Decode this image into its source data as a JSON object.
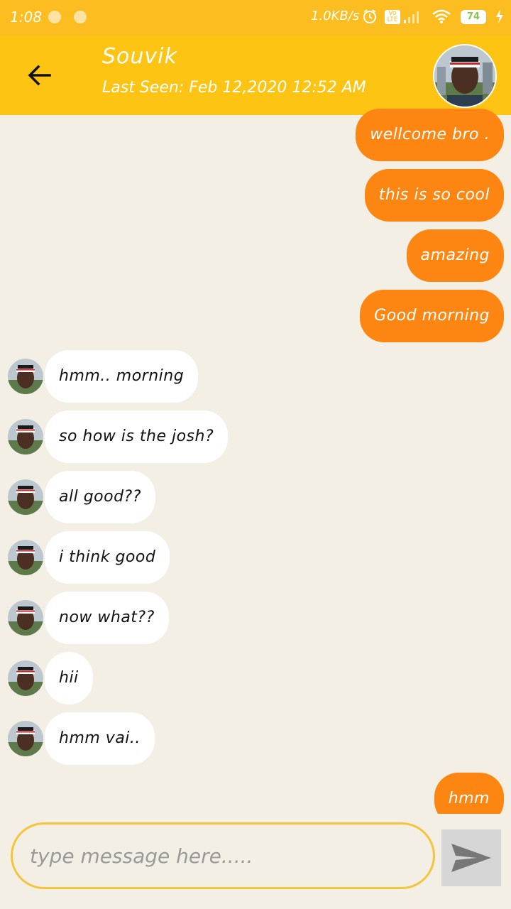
{
  "status_bar": {
    "time": "1:08",
    "net_speed": "1.0KB/s",
    "volte": "Vo LTE",
    "battery": "74"
  },
  "header": {
    "contact_name": "Souvik",
    "last_seen": "Last Seen: Feb 12,2020 12:52 AM"
  },
  "messages": [
    {
      "dir": "out",
      "text": "wellcome bro ."
    },
    {
      "dir": "out",
      "text": "this is so cool"
    },
    {
      "dir": "out",
      "text": "amazing"
    },
    {
      "dir": "out",
      "text": "Good morning"
    },
    {
      "dir": "in",
      "text": "hmm.. morning"
    },
    {
      "dir": "in",
      "text": "so how is the josh?"
    },
    {
      "dir": "in",
      "text": "all good??"
    },
    {
      "dir": "in",
      "text": "i think good"
    },
    {
      "dir": "in",
      "text": "now what??"
    },
    {
      "dir": "in",
      "text": "hii"
    },
    {
      "dir": "in",
      "text": "hmm vai.."
    },
    {
      "dir": "out",
      "text": "hmm"
    }
  ],
  "composer": {
    "placeholder": "type message here.....",
    "value": ""
  },
  "colors": {
    "status_bar": "#fbbd1f",
    "header": "#fdc414",
    "outgoing_bubble": "#fd8613",
    "incoming_bubble": "#ffffff",
    "chat_background": "#f4efe4",
    "input_border": "#f3c43c"
  },
  "icons": {
    "back": "arrow-left-icon",
    "send": "send-icon",
    "alarm": "alarm-icon",
    "signal": "signal-icon",
    "wifi": "wifi-icon",
    "battery": "battery-icon",
    "charging": "bolt-icon"
  }
}
